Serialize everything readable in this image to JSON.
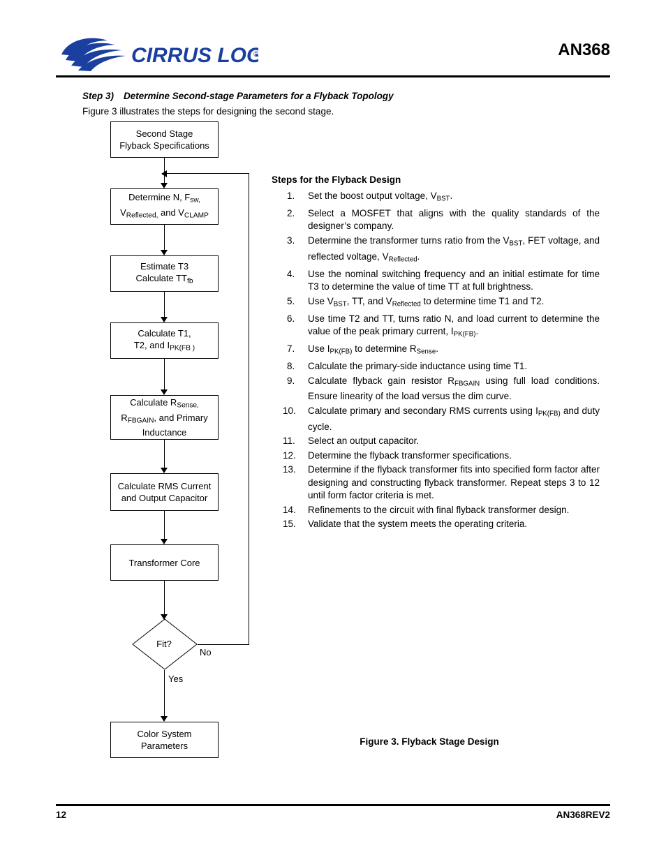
{
  "header": {
    "logo_text": "CIRRUS LOGIC",
    "logo_reg": "®",
    "doc_id": "AN368"
  },
  "step": {
    "number": "Step 3)",
    "title": "Determine Second-stage Parameters for a Flyback Topology",
    "intro": "Figure 3 illustrates the steps for designing the second stage."
  },
  "flow": {
    "boxes": [
      {
        "line1": "Second Stage",
        "line2": "Flyback Specifications"
      },
      {
        "line1": "Determine N, F",
        "sub1": "sw,",
        "line2_pre": "V",
        "sub2": "Reflected,",
        "line2_mid": " and V",
        "sub3": "CLAMP"
      },
      {
        "line1": "Estimate T3",
        "line2_pre": "Calculate TT",
        "sub2": "fb"
      },
      {
        "line1": "Calculate T1,",
        "line2_pre": "T2, and I",
        "sub2": "PK(FB )"
      },
      {
        "line1_pre": "Calculate R",
        "sub1": "Sense,",
        "line2_pre": "R",
        "sub2": "FBGAIN",
        "line2_mid": ", and Primary",
        "line3": "Inductance"
      },
      {
        "line1": "Calculate RMS Current",
        "line2": "and Output Capacitor"
      },
      {
        "line1": "Transformer Core"
      },
      {
        "line1": "Color System",
        "line2": "Parameters"
      }
    ],
    "decision": "Fit?",
    "branch_no": "No",
    "branch_yes": "Yes"
  },
  "steps_panel": {
    "title": "Steps for the Flyback Design",
    "items": [
      {
        "n": "1.",
        "html": "Set the boost output voltage, V<sub>BST</sub>."
      },
      {
        "n": "2.",
        "html": "Select a MOSFET that aligns with the quality standards of the designer’s company."
      },
      {
        "n": "3.",
        "html": "Determine the transformer turns ratio from the V<sub>BST</sub>, FET voltage, and reflected voltage, V<sub>Reflected</sub>."
      },
      {
        "n": "4.",
        "html": "Use the nominal switching frequency and an initial estimate for time T3 to determine the value of time TT at full brightness."
      },
      {
        "n": "5.",
        "html": "Use V<sub>BST</sub>, TT, and V<sub>Reflected</sub> to determine time T1 and T2."
      },
      {
        "n": "6.",
        "html": "Use time T2 and TT, turns ratio N, and load current to determine the value of the peak primary current, I<sub>PK(FB)</sub>."
      },
      {
        "n": "7.",
        "html": "Use I<sub>PK(FB)</sub> to determine R<sub>Sense</sub>."
      },
      {
        "n": "8.",
        "html": "Calculate the primary-side inductance using time T1."
      },
      {
        "n": "9.",
        "html": "Calculate flyback gain resistor R<sub>FBGAIN</sub> using full load conditions. Ensure linearity of the load versus the dim curve."
      },
      {
        "n": "10.",
        "html": "Calculate primary and secondary RMS currents using I<sub>PK(FB)</sub> and duty cycle."
      },
      {
        "n": "11.",
        "html": "Select an output capacitor."
      },
      {
        "n": "12.",
        "html": "Determine the flyback transformer specifications."
      },
      {
        "n": "13.",
        "html": "Determine if the flyback transformer fits into specified form factor after designing and constructing flyback transformer. Repeat steps 3 to 12 until form factor criteria is met."
      },
      {
        "n": "14.",
        "html": "Refinements to the circuit with final flyback transformer design."
      },
      {
        "n": "15.",
        "html": "Validate that the system meets the operating criteria."
      }
    ]
  },
  "figure": {
    "caption": "Figure 3.  Flyback Stage Design"
  },
  "footer": {
    "page_number": "12",
    "doc_rev": "AN368REV2"
  },
  "colors": {
    "logo_blue": "#1a3f9e",
    "text": "#000000",
    "rule": "#000000"
  }
}
